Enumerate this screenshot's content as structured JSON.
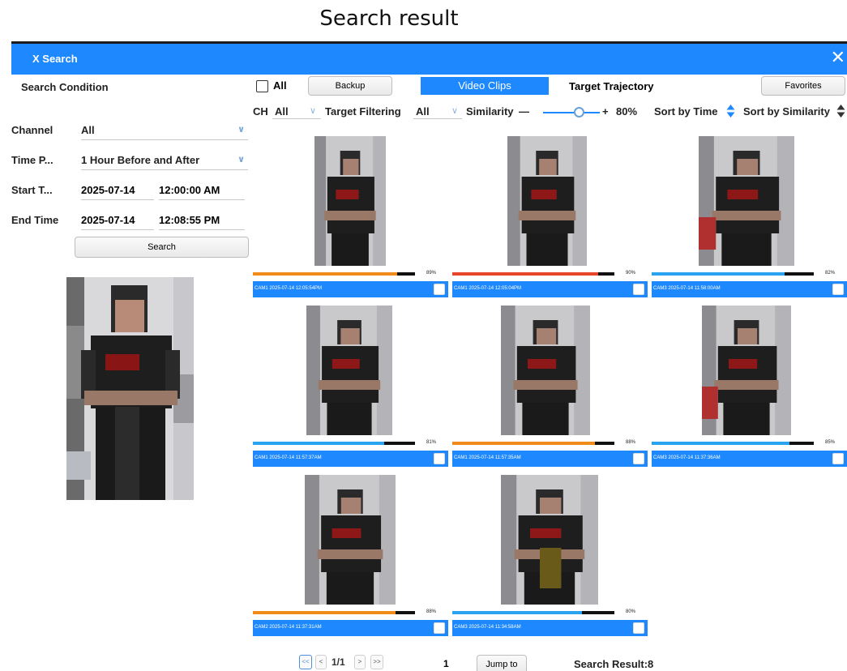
{
  "page_caption": "Search result",
  "window": {
    "title": "X Search",
    "close_icon": "close-icon"
  },
  "colors": {
    "accent": "#1e88ff",
    "bar_orange": "#f08a1a",
    "bar_red": "#e8462a",
    "bar_blue": "#29a3f0"
  },
  "left_panel": {
    "title": "Search Condition",
    "channel": {
      "label": "Channel",
      "value": "All"
    },
    "time_period": {
      "label": "Time P...",
      "value": "1 Hour Before and After"
    },
    "start_time": {
      "label": "Start T...",
      "date": "2025-07-14",
      "time": "12:00:00 AM"
    },
    "end_time": {
      "label": "End Time",
      "date": "2025-07-14",
      "time": "12:08:55 PM"
    },
    "search_button": "Search"
  },
  "toolbar": {
    "all_label": "All",
    "backup_button": "Backup",
    "tab_video_clips": "Video Clips",
    "tab_target_trajectory": "Target Trajectory",
    "favorites_button": "Favorites"
  },
  "filters": {
    "ch_label": "CH",
    "ch_value": "All",
    "target_filtering_label": "Target Filtering",
    "target_filtering_value": "All",
    "similarity_label": "Similarity",
    "similarity_minus": "—",
    "similarity_plus": "+",
    "similarity_value": "80%",
    "sort_by_time": "Sort by Time",
    "sort_by_similarity": "Sort by Similarity"
  },
  "results": [
    {
      "caption": "CAM1 2025-07-14 12:05:54PM",
      "similarity": "89%",
      "level": 89,
      "bar_color": "#f08a1a"
    },
    {
      "caption": "CAM1 2025-07-14 12:05:04PM",
      "similarity": "90%",
      "level": 90,
      "bar_color": "#e8462a"
    },
    {
      "caption": "CAM3 2025-07-14 11:58:00AM",
      "similarity": "82%",
      "level": 82,
      "bar_color": "#29a3f0"
    },
    {
      "caption": "CAM1 2025-07-14 11:57:37AM",
      "similarity": "81%",
      "level": 81,
      "bar_color": "#29a3f0"
    },
    {
      "caption": "CAM1 2025-07-14 11:57:35AM",
      "similarity": "88%",
      "level": 88,
      "bar_color": "#f08a1a"
    },
    {
      "caption": "CAM3 2025-07-14 11:37:36AM",
      "similarity": "85%",
      "level": 85,
      "bar_color": "#29a3f0"
    },
    {
      "caption": "CAM2 2025-07-14 11:37:31AM",
      "similarity": "88%",
      "level": 88,
      "bar_color": "#f08a1a"
    },
    {
      "caption": "CAM3 2025-07-14 11:34:58AM",
      "similarity": "80%",
      "level": 80,
      "bar_color": "#29a3f0"
    }
  ],
  "pagination": {
    "first": "<<",
    "prev": "<",
    "page_label": "1/1",
    "next": ">",
    "last": ">>",
    "jump_value": "1",
    "jump_button": "Jump to",
    "result_label": "Search Result:8"
  }
}
